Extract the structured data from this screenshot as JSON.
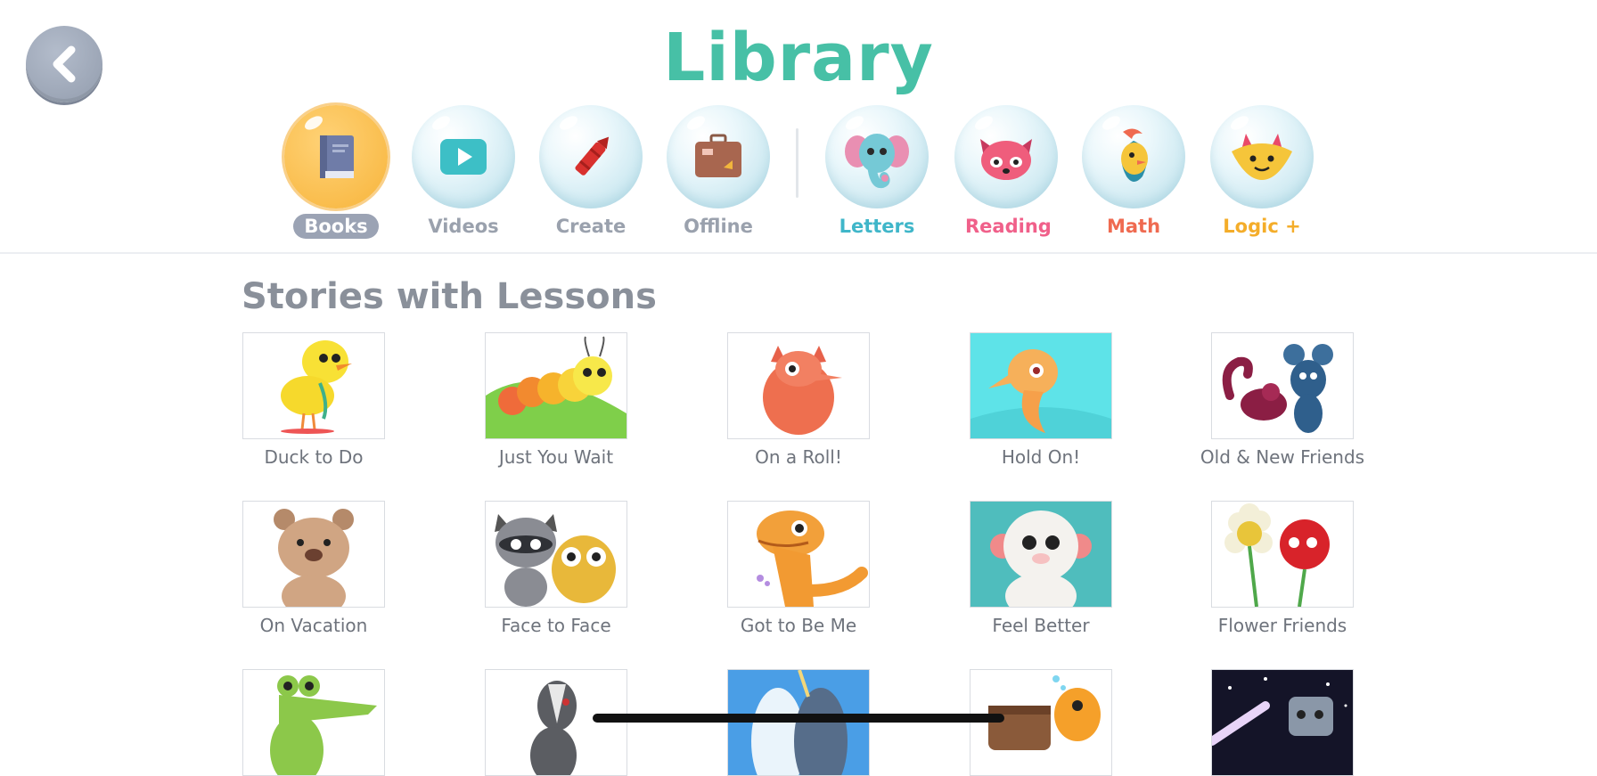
{
  "header": {
    "title": "Library"
  },
  "tabs": [
    {
      "label": "Books",
      "icon": "book-icon",
      "active": true,
      "color": "#ffffff"
    },
    {
      "label": "Videos",
      "icon": "play-icon",
      "color": "#9aa1ad"
    },
    {
      "label": "Create",
      "icon": "crayon-icon",
      "color": "#9aa1ad"
    },
    {
      "label": "Offline",
      "icon": "suitcase-icon",
      "color": "#9aa1ad"
    },
    {
      "label": "Letters",
      "icon": "elephant-icon",
      "color": "#3fb6c9"
    },
    {
      "label": "Reading",
      "icon": "red-panda-icon",
      "color": "#f0608a"
    },
    {
      "label": "Math",
      "icon": "bird-icon",
      "color": "#ef6a50"
    },
    {
      "label": "Logic +",
      "icon": "fox-icon",
      "color": "#f4ad2a"
    }
  ],
  "section": {
    "title": "Stories with Lessons"
  },
  "books": [
    {
      "label": "Duck to Do"
    },
    {
      "label": "Just You Wait"
    },
    {
      "label": "On a Roll!"
    },
    {
      "label": "Hold On!"
    },
    {
      "label": "Old & New Friends"
    },
    {
      "label": "On Vacation"
    },
    {
      "label": "Face to Face"
    },
    {
      "label": "Got to Be Me"
    },
    {
      "label": "Feel Better"
    },
    {
      "label": "Flower Friends"
    },
    {
      "label": ""
    },
    {
      "label": ""
    },
    {
      "label": ""
    },
    {
      "label": ""
    },
    {
      "label": ""
    }
  ],
  "colors": {
    "accent": "#47c0a6",
    "active_tab": "#f7b43b"
  }
}
